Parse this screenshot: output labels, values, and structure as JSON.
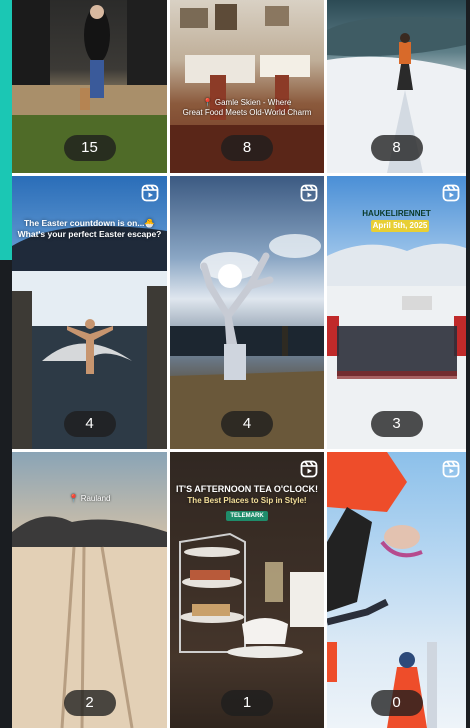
{
  "tiles": [
    {
      "count": "15",
      "reel": false
    },
    {
      "count": "8",
      "reel": false,
      "caption": "📍 Gamle Skien - Where",
      "caption2": "Great Food Meets Old-World Charm"
    },
    {
      "count": "8",
      "reel": false
    },
    {
      "count": "4",
      "reel": true,
      "caption": "The Easter countdown is on...🐣",
      "caption2": "What's your perfect Easter escape?"
    },
    {
      "count": "4",
      "reel": true
    },
    {
      "count": "3",
      "reel": true,
      "caption": "HAUKELIRENNET",
      "caption2": "April 5th, 2025"
    },
    {
      "count": "2",
      "reel": false,
      "caption": "Rauland"
    },
    {
      "count": "1",
      "reel": true,
      "caption": "IT'S AFTERNOON TEA O'CLOCK!",
      "caption2": "The Best Places to Sip in Style!",
      "caption3": "TELEMARK"
    },
    {
      "count": "0",
      "reel": true
    }
  ]
}
